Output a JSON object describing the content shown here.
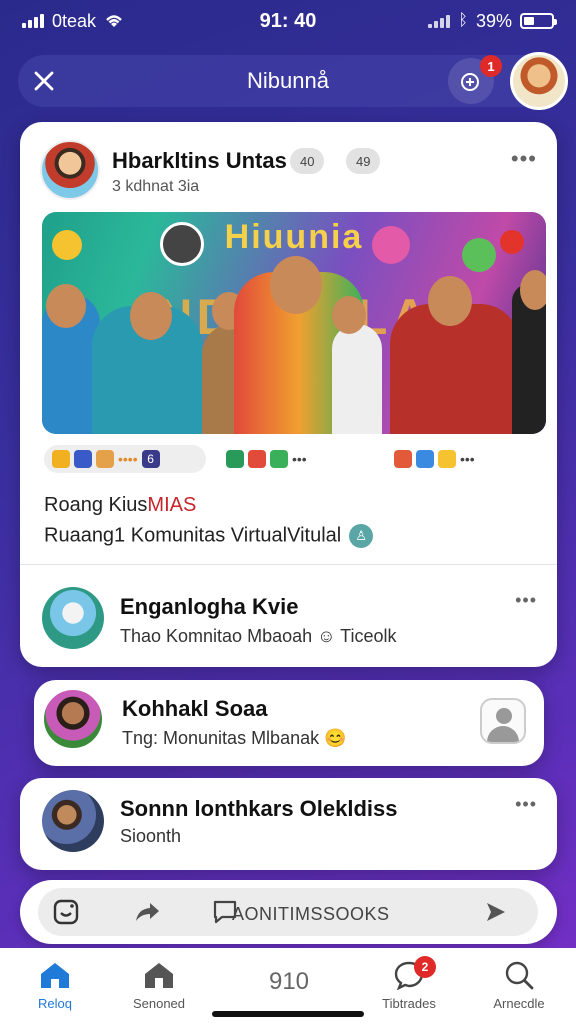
{
  "status_bar": {
    "carrier": "0teak",
    "time": "91: 40",
    "battery": "39%",
    "battery_level": 0.39
  },
  "header": {
    "title": "Nibunnå",
    "notification_count": "1"
  },
  "post": {
    "author": "Hbarkltins Untas",
    "subtitle": "3 kdhnat 3ia",
    "tags": [
      "40",
      "49"
    ],
    "banner_text_top": "Hiuunia",
    "banner_text_main": "NDNHALA",
    "reactions": [
      "6",
      "•••",
      "•••"
    ],
    "section_title_main": "Roang Kius",
    "section_title_accent": "MIAS",
    "section_subtitle": "Ruaang1 Komunitas VirtualVitulal",
    "verified_symbol": "♙"
  },
  "rows": [
    {
      "title": "Enganlogha Kvie",
      "subtitle": "Thao Komnitao  Mbaoah ☺ Ticeolk"
    },
    {
      "title": "Kohhakl Soaa",
      "subtitle": "Tng:  Monunitas Mlbanak 😊"
    },
    {
      "title": "Sonnn lonthkars Olekldiss",
      "subtitle": "Sioonth"
    }
  ],
  "composer": {
    "placeholder": "AONITIMSSOOKS"
  },
  "tabs": [
    {
      "label": "Reloq",
      "icon": "home-icon"
    },
    {
      "label": "Senoned",
      "icon": "store-icon"
    },
    {
      "label": "910",
      "icon": "none"
    },
    {
      "label": "Tibtrades",
      "icon": "chat-icon",
      "badge": "2"
    },
    {
      "label": "Arnecdle",
      "icon": "search-icon"
    }
  ],
  "colors": {
    "accent_blue": "#1f7ad8",
    "badge_red": "#e02a2a",
    "title_accent": "#c8242a"
  }
}
